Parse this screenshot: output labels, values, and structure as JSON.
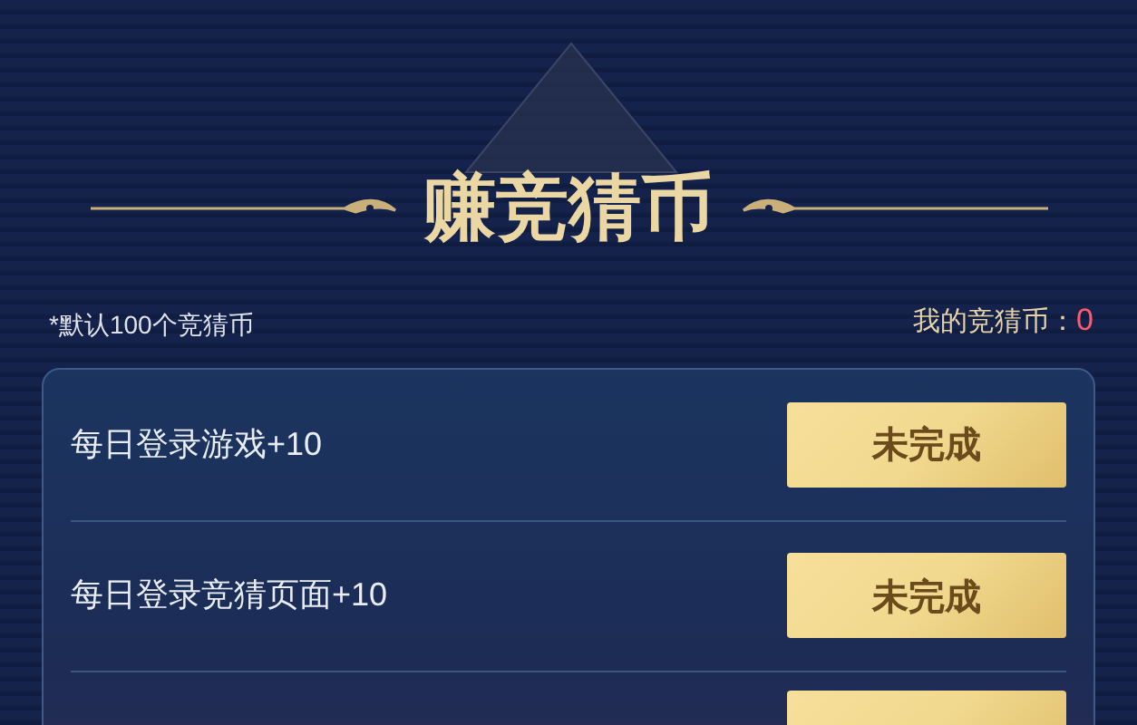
{
  "title": "赚竞猜币",
  "note": "*默认100个竞猜币",
  "balance": {
    "label": "我的竞猜币：",
    "value": "0"
  },
  "tasks": [
    {
      "kind": "task",
      "label": "每日登录游戏+10",
      "button": "未完成"
    },
    {
      "kind": "task",
      "label": "每日登录竞猜页面+10",
      "button": "未完成"
    },
    {
      "kind": "cut-off"
    }
  ]
}
